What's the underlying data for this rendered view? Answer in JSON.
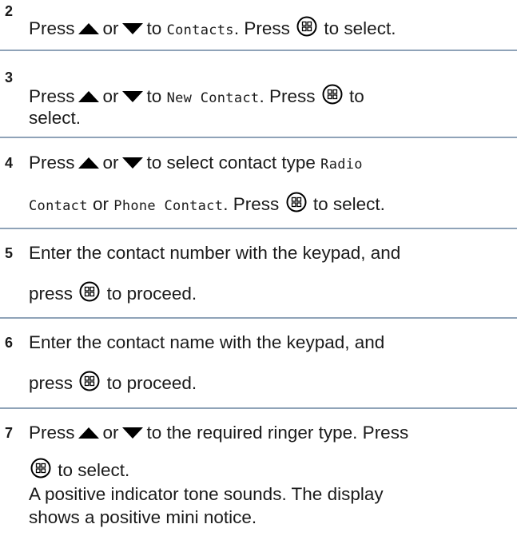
{
  "steps": [
    {
      "number": "2",
      "line1": {
        "press": "Press",
        "or": "or",
        "to": "to",
        "target": "Contacts",
        "press2": ". Press",
        "end": "to select."
      }
    },
    {
      "number": "3",
      "line1": {
        "press": "Press",
        "or": "or",
        "to": "to",
        "target": "New Contact",
        "press2": ". Press",
        "end": "to"
      },
      "line2": "select."
    },
    {
      "number": "4",
      "line1": {
        "press": "Press",
        "or": "or",
        "to": "to select contact type",
        "target": "Radio"
      },
      "line2": {
        "target1": "Contact",
        "or": "or",
        "target2": "Phone Contact",
        "press2": ". Press",
        "end": "to select."
      }
    },
    {
      "number": "5",
      "line1": "Enter the contact number with the keypad, and",
      "line2": {
        "start": "press",
        "end": "to proceed."
      }
    },
    {
      "number": "6",
      "line1": "Enter the contact name with the keypad, and",
      "line2": {
        "start": "press",
        "end": "to proceed."
      }
    },
    {
      "number": "7",
      "line1": {
        "press": "Press",
        "or": "or",
        "end": "to the required ringer type. Press"
      },
      "line2": "to select.",
      "line3": "A positive indicator tone sounds. The display",
      "line4": "shows a positive mini notice."
    }
  ],
  "icons": {
    "up": "up-arrow-icon",
    "down": "down-arrow-icon",
    "menu": "menu-ok-button-icon"
  }
}
